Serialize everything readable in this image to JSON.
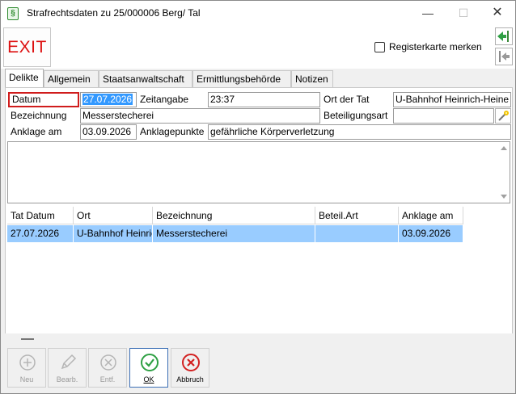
{
  "window": {
    "title": "Strafrechtsdaten zu 25/000006 Berg/ Tal",
    "app_icon": "§",
    "minimize_glyph": "—",
    "maximize_glyph": "☐",
    "close_glyph": "✕"
  },
  "toolbar": {
    "exit_label": "EXIT",
    "register_label": "Registerkarte merken",
    "register_checked": false
  },
  "tabs": [
    {
      "label": "Delikte",
      "active": true
    },
    {
      "label": "Allgemein",
      "active": false
    },
    {
      "label": "Staatsanwaltschaft",
      "active": false
    },
    {
      "label": "Ermittlungsbehörde",
      "active": false
    },
    {
      "label": "Notizen",
      "active": false
    }
  ],
  "form": {
    "datum_label": "Datum",
    "datum_value": "27.07.2026",
    "zeitangabe_label": "Zeitangabe",
    "zeitangabe_value": "23:37",
    "ort_label": "Ort der Tat",
    "ort_value": "U-Bahnhof Heinrich-Heine",
    "bezeichnung_label": "Bezeichnung",
    "bezeichnung_value": "Messerstecherei",
    "beteiligungsart_label": "Beteiligungsart",
    "beteiligungsart_value": "",
    "anklage_label": "Anklage am",
    "anklage_value": "03.09.2026",
    "anklagepunkte_label": "Anklagepunkte",
    "anklagepunkte_value": "gefährliche Körperverletzung"
  },
  "table": {
    "columns": [
      "Tat Datum",
      "Ort",
      "Bezeichnung",
      "Beteil.Art",
      "Anklage am"
    ],
    "rows": [
      [
        "27.07.2026",
        "U-Bahnhof Heinrich-Heine",
        "Messerstecherei",
        "",
        "03.09.2026"
      ]
    ]
  },
  "buttons": {
    "new": "Neu",
    "edit": "Bearb.",
    "remove": "Entf.",
    "ok": "OK",
    "cancel": "Abbruch"
  },
  "colors": {
    "selection": "#3399ff",
    "row_highlight": "#99ccff",
    "exit_text": "#dd1111",
    "ok_green": "#2ea043",
    "cancel_red": "#d32020",
    "datum_border": "#d01c1c"
  }
}
